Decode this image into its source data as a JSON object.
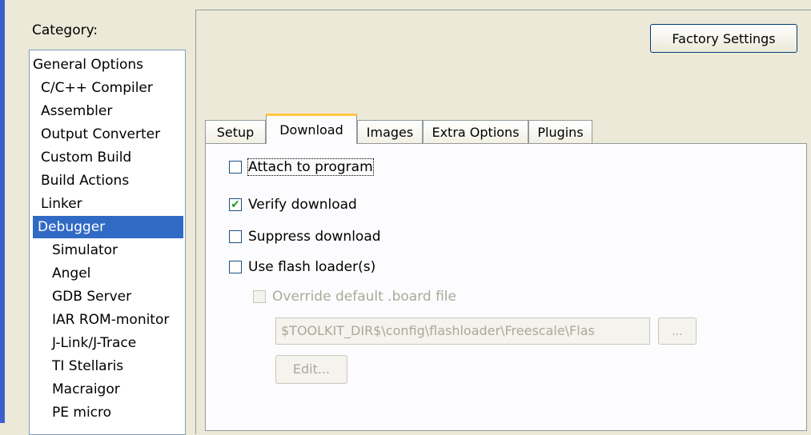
{
  "category_label": "Category:",
  "categories": [
    {
      "label": "General Options"
    },
    {
      "label": "C/C++ Compiler"
    },
    {
      "label": "Assembler"
    },
    {
      "label": "Output Converter"
    },
    {
      "label": "Custom Build"
    },
    {
      "label": "Build Actions"
    },
    {
      "label": "Linker"
    },
    {
      "label": "Debugger",
      "selected": true
    },
    {
      "label": "Simulator"
    },
    {
      "label": "Angel"
    },
    {
      "label": "GDB Server"
    },
    {
      "label": "IAR ROM-monitor"
    },
    {
      "label": "J-Link/J-Trace"
    },
    {
      "label": "TI Stellaris"
    },
    {
      "label": "Macraigor"
    },
    {
      "label": "PE micro"
    }
  ],
  "factory_settings_label": "Factory Settings",
  "tabs": [
    {
      "label": "Setup"
    },
    {
      "label": "Download",
      "active": true
    },
    {
      "label": "Images"
    },
    {
      "label": "Extra Options"
    },
    {
      "label": "Plugins"
    }
  ],
  "download": {
    "attach_label": "Attach to program",
    "attach_checked": false,
    "verify_label": "Verify download",
    "verify_checked": true,
    "suppress_label": "Suppress download",
    "suppress_checked": false,
    "flash_label": "Use flash loader(s)",
    "flash_checked": false,
    "override_label": "Override default .board file",
    "override_checked": false,
    "board_path": "$TOOLKIT_DIR$\\config\\flashloader\\Freescale\\Flas",
    "browse_label": "...",
    "edit_label": "Edit..."
  }
}
